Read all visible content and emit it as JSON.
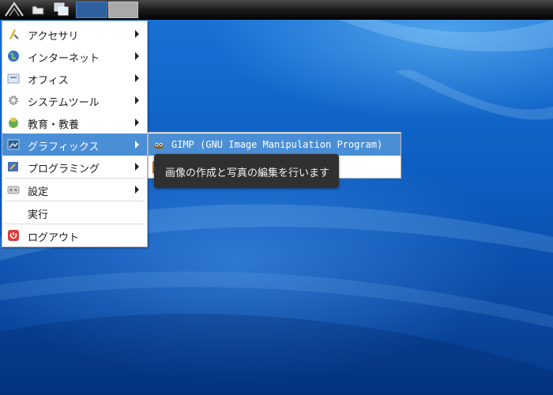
{
  "panel": {
    "icons": [
      "app-menu-logo-icon",
      "folder-icon",
      "show-desktop-icon"
    ]
  },
  "menu": {
    "items": [
      {
        "label": "アクセサリ",
        "icon": "accessories-icon",
        "submenu": true
      },
      {
        "label": "インターネット",
        "icon": "globe-icon",
        "submenu": true
      },
      {
        "label": "オフィス",
        "icon": "office-icon",
        "submenu": true
      },
      {
        "label": "システムツール",
        "icon": "gear-icon",
        "submenu": true
      },
      {
        "label": "教育・教養",
        "icon": "education-icon",
        "submenu": true
      },
      {
        "label": "グラフィックス",
        "icon": "graphics-icon",
        "submenu": true,
        "highlighted": true
      },
      {
        "label": "プログラミング",
        "icon": "programming-icon",
        "submenu": true
      },
      {
        "label": "設定",
        "icon": "settings-icon",
        "submenu": true
      },
      {
        "label": "実行",
        "icon": "",
        "submenu": false
      },
      {
        "label": "ログアウト",
        "icon": "logout-icon",
        "submenu": false
      }
    ]
  },
  "submenu": {
    "items": [
      {
        "label": "GIMP (GNU Image Manipulation Program)",
        "icon": "gimp-icon",
        "highlighted": true
      }
    ]
  },
  "tooltip": {
    "text": "画像の作成と写真の編集を行います"
  },
  "colors": {
    "highlight": "#4a8fd6",
    "tooltip_bg": "#303030",
    "panel_bg": "#1a1a1a",
    "wallpaper": "#0d5dc0"
  }
}
